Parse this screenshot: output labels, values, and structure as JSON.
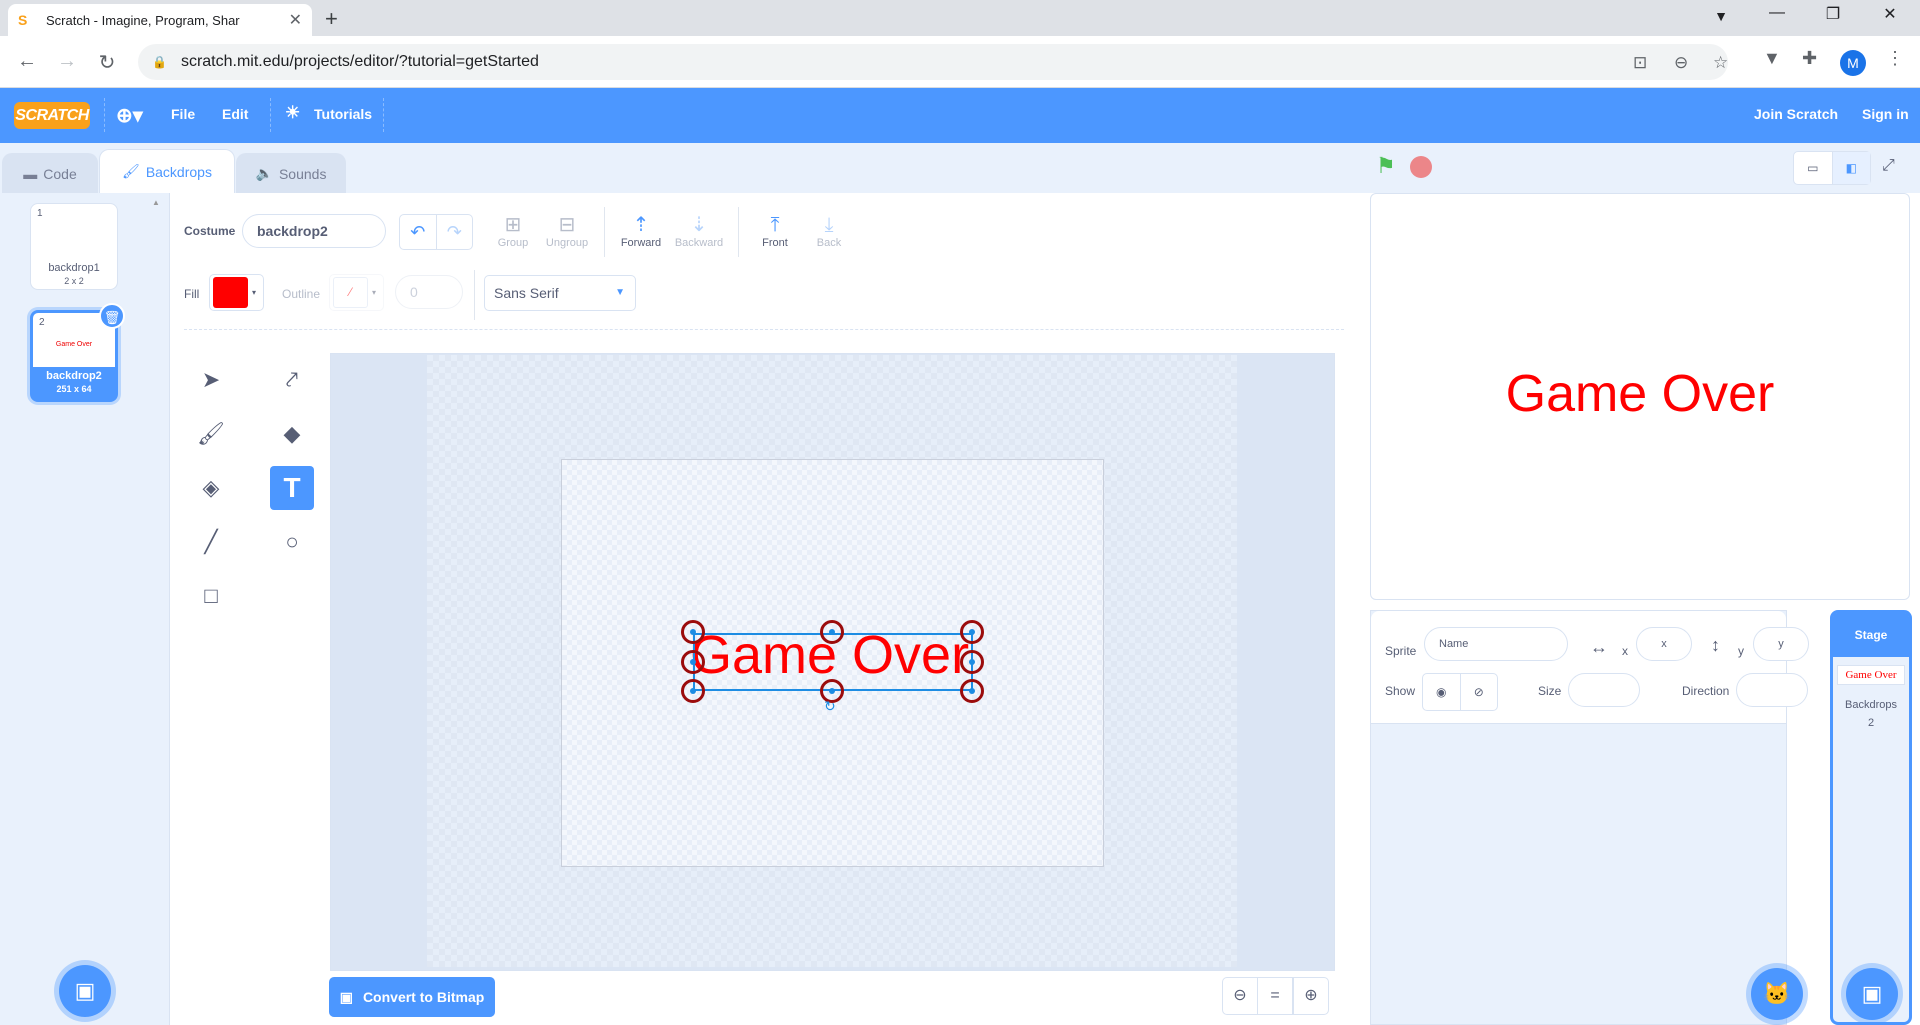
{
  "browser": {
    "tab_title": "Scratch - Imagine, Program, Shar",
    "tab_favicon": "S",
    "url": "scratch.mit.edu/projects/editor/?tutorial=getStarted",
    "avatar_initial": "M"
  },
  "menu": {
    "logo": "SCRATCH",
    "file": "File",
    "edit": "Edit",
    "tutorials": "Tutorials",
    "join": "Join Scratch",
    "signin": "Sign in"
  },
  "tabs": {
    "code": "Code",
    "backdrops": "Backdrops",
    "sounds": "Sounds"
  },
  "backdrops": [
    {
      "num": "1",
      "name": "backdrop1",
      "dims": "2 x 2"
    },
    {
      "num": "2",
      "name": "backdrop2",
      "dims": "251 x 64",
      "thumb_text": "Game Over"
    }
  ],
  "editor": {
    "costume_label": "Costume",
    "costume_name": "backdrop2",
    "group": "Group",
    "ungroup": "Ungroup",
    "forward": "Forward",
    "backward": "Backward",
    "front": "Front",
    "back": "Back",
    "fill_label": "Fill",
    "fill_color": "#ff0000",
    "outline_label": "Outline",
    "outline_width": "0",
    "font": "Sans Serif",
    "canvas_text": "Game Over",
    "convert_button": "Convert to Bitmap",
    "zoom_reset": "="
  },
  "stage": {
    "display_text": "Game Over",
    "flag_color": "#4cbf56",
    "stop_color": "#ec5959"
  },
  "sprite_info": {
    "sprite_label": "Sprite",
    "name_placeholder": "Name",
    "x_label": "x",
    "x_placeholder": "x",
    "y_label": "y",
    "y_placeholder": "y",
    "show_label": "Show",
    "size_label": "Size",
    "direction_label": "Direction"
  },
  "stage_panel": {
    "title": "Stage",
    "thumb_text": "Game Over",
    "backdrops_label": "Backdrops",
    "backdrops_count": "2"
  }
}
